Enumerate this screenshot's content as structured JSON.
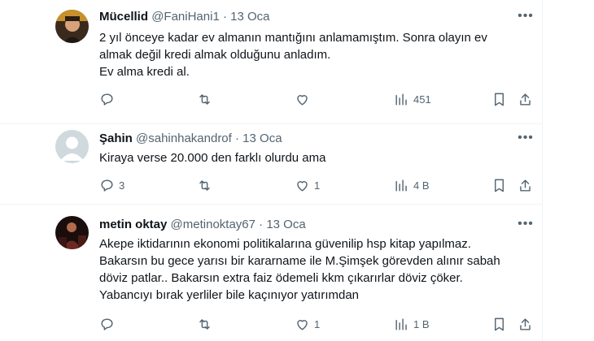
{
  "tweets": [
    {
      "name": "Mücellid",
      "handle": "@FaniHani1",
      "date": "13 Oca",
      "lines": [
        "2 yıl önceye kadar ev almanın mantığını anlamamıştım.  Sonra olayın ev",
        "almak değil kredi almak olduğunu anladım.",
        "Ev alma kredi al."
      ],
      "replies": "",
      "retweets": "",
      "likes": "",
      "views": "451"
    },
    {
      "name": "Şahin",
      "handle": "@sahinhakandrof",
      "date": "13 Oca",
      "lines": [
        "Kiraya verse 20.000 den farklı olurdu ama"
      ],
      "replies": "3",
      "retweets": "",
      "likes": "1",
      "views": "4 B"
    },
    {
      "name": "metin oktay",
      "handle": "@metinoktay67",
      "date": "13 Oca",
      "lines": [
        "Akepe iktidarının ekonomi politikalarına güvenilip hsp kitap yapılmaz.",
        "Bakarsın bu gece yarısı bir kararname ile   M.Şimşek görevden alınır sabah",
        "döviz patlar.. Bakarsın extra faiz ödemeli kkm çıkarırlar döviz çöker.",
        "Yabancıyı bırak yerliler bile kaçınıyor yatırımdan"
      ],
      "replies": "",
      "retweets": "",
      "likes": "1",
      "views": "1 B"
    }
  ],
  "separator_dot": "·",
  "icons": [
    "reply-icon",
    "retweet-icon",
    "like-icon",
    "views-icon",
    "bookmark-icon",
    "share-icon",
    "more-icon"
  ],
  "colors": {
    "text": "#0f1419",
    "secondary": "#536471",
    "divider": "#eff3f4"
  }
}
